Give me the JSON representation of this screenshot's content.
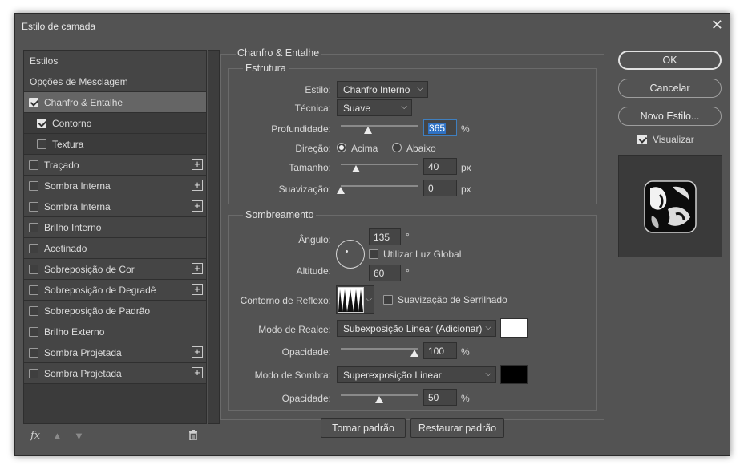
{
  "window": {
    "title": "Estilo de camada"
  },
  "sidebar": {
    "items": [
      {
        "label": "Estilos"
      },
      {
        "label": "Opções de Mesclagem"
      },
      {
        "label": "Chanfro & Entalhe",
        "checked": true
      },
      {
        "label": "Contorno",
        "checked": true
      },
      {
        "label": "Textura",
        "checked": false
      },
      {
        "label": "Traçado",
        "checked": false,
        "plus": "+"
      },
      {
        "label": "Sombra Interna",
        "checked": false,
        "plus": "+"
      },
      {
        "label": "Sombra Interna",
        "checked": false,
        "plus": "+"
      },
      {
        "label": "Brilho Interno",
        "checked": false
      },
      {
        "label": "Acetinado",
        "checked": false
      },
      {
        "label": "Sobreposição de Cor",
        "checked": false,
        "plus": "+"
      },
      {
        "label": "Sobreposição de Degradê",
        "checked": false,
        "plus": "+"
      },
      {
        "label": "Sobreposição de Padrão",
        "checked": false
      },
      {
        "label": "Brilho Externo",
        "checked": false
      },
      {
        "label": "Sombra Projetada",
        "checked": false,
        "plus": "+"
      },
      {
        "label": "Sombra Projetada",
        "checked": false,
        "plus": "+"
      }
    ],
    "icons": {
      "fx": "fx",
      "up": "arrow-up-icon",
      "down": "arrow-down-icon",
      "trash": "trash-icon"
    }
  },
  "panel": {
    "title": "Chanfro & Entalhe",
    "estrutura": {
      "title": "Estrutura",
      "estilo_label": "Estilo:",
      "estilo_value": "Chanfro Interno",
      "tecnica_label": "Técnica:",
      "tecnica_value": "Suave",
      "profundidade_label": "Profundidade:",
      "profundidade_value": "365",
      "profundidade_unit": "%",
      "profundidade_slider_fraction": 0.35,
      "direcao_label": "Direção:",
      "direcao_acima": "Acima",
      "direcao_abaixo": "Abaixo",
      "direcao_selected": "Acima",
      "tamanho_label": "Tamanho:",
      "tamanho_value": "40",
      "tamanho_unit": "px",
      "tamanho_slider_fraction": 0.2,
      "suavizacao_label": "Suavização:",
      "suavizacao_value": "0",
      "suavizacao_unit": "px",
      "suavizacao_slider_fraction": 0.0
    },
    "sombreamento": {
      "title": "Sombreamento",
      "angulo_label": "Ângulo:",
      "angulo_value": "135",
      "angulo_unit": "°",
      "luz_global_label": "Utilizar Luz Global",
      "luz_global_checked": false,
      "altitude_label": "Altitude:",
      "altitude_value": "60",
      "altitude_unit": "°",
      "contorno_label": "Contorno de Reflexo:",
      "serrilhado_label": "Suavização de Serrilhado",
      "serrilhado_checked": false,
      "realce_label": "Modo de Realce:",
      "realce_value": "Subexposição Linear (Adicionar)",
      "realce_color": "#ffffff",
      "opacidade1_label": "Opacidade:",
      "opacidade1_value": "100",
      "opacidade1_unit": "%",
      "opacidade1_slider_fraction": 0.96,
      "sombra_label": "Modo de Sombra:",
      "sombra_value": "Superexposição Linear",
      "sombra_color": "#000000",
      "opacidade2_label": "Opacidade:",
      "opacidade2_value": "50",
      "opacidade2_unit": "%",
      "opacidade2_slider_fraction": 0.5
    },
    "tornar_padrao": "Tornar padrão",
    "restaurar_padrao": "Restaurar padrão"
  },
  "buttons": {
    "ok": "OK",
    "cancelar": "Cancelar",
    "novo_estilo": "Novo Estilo...",
    "visualizar_label": "Visualizar",
    "visualizar_checked": true
  }
}
